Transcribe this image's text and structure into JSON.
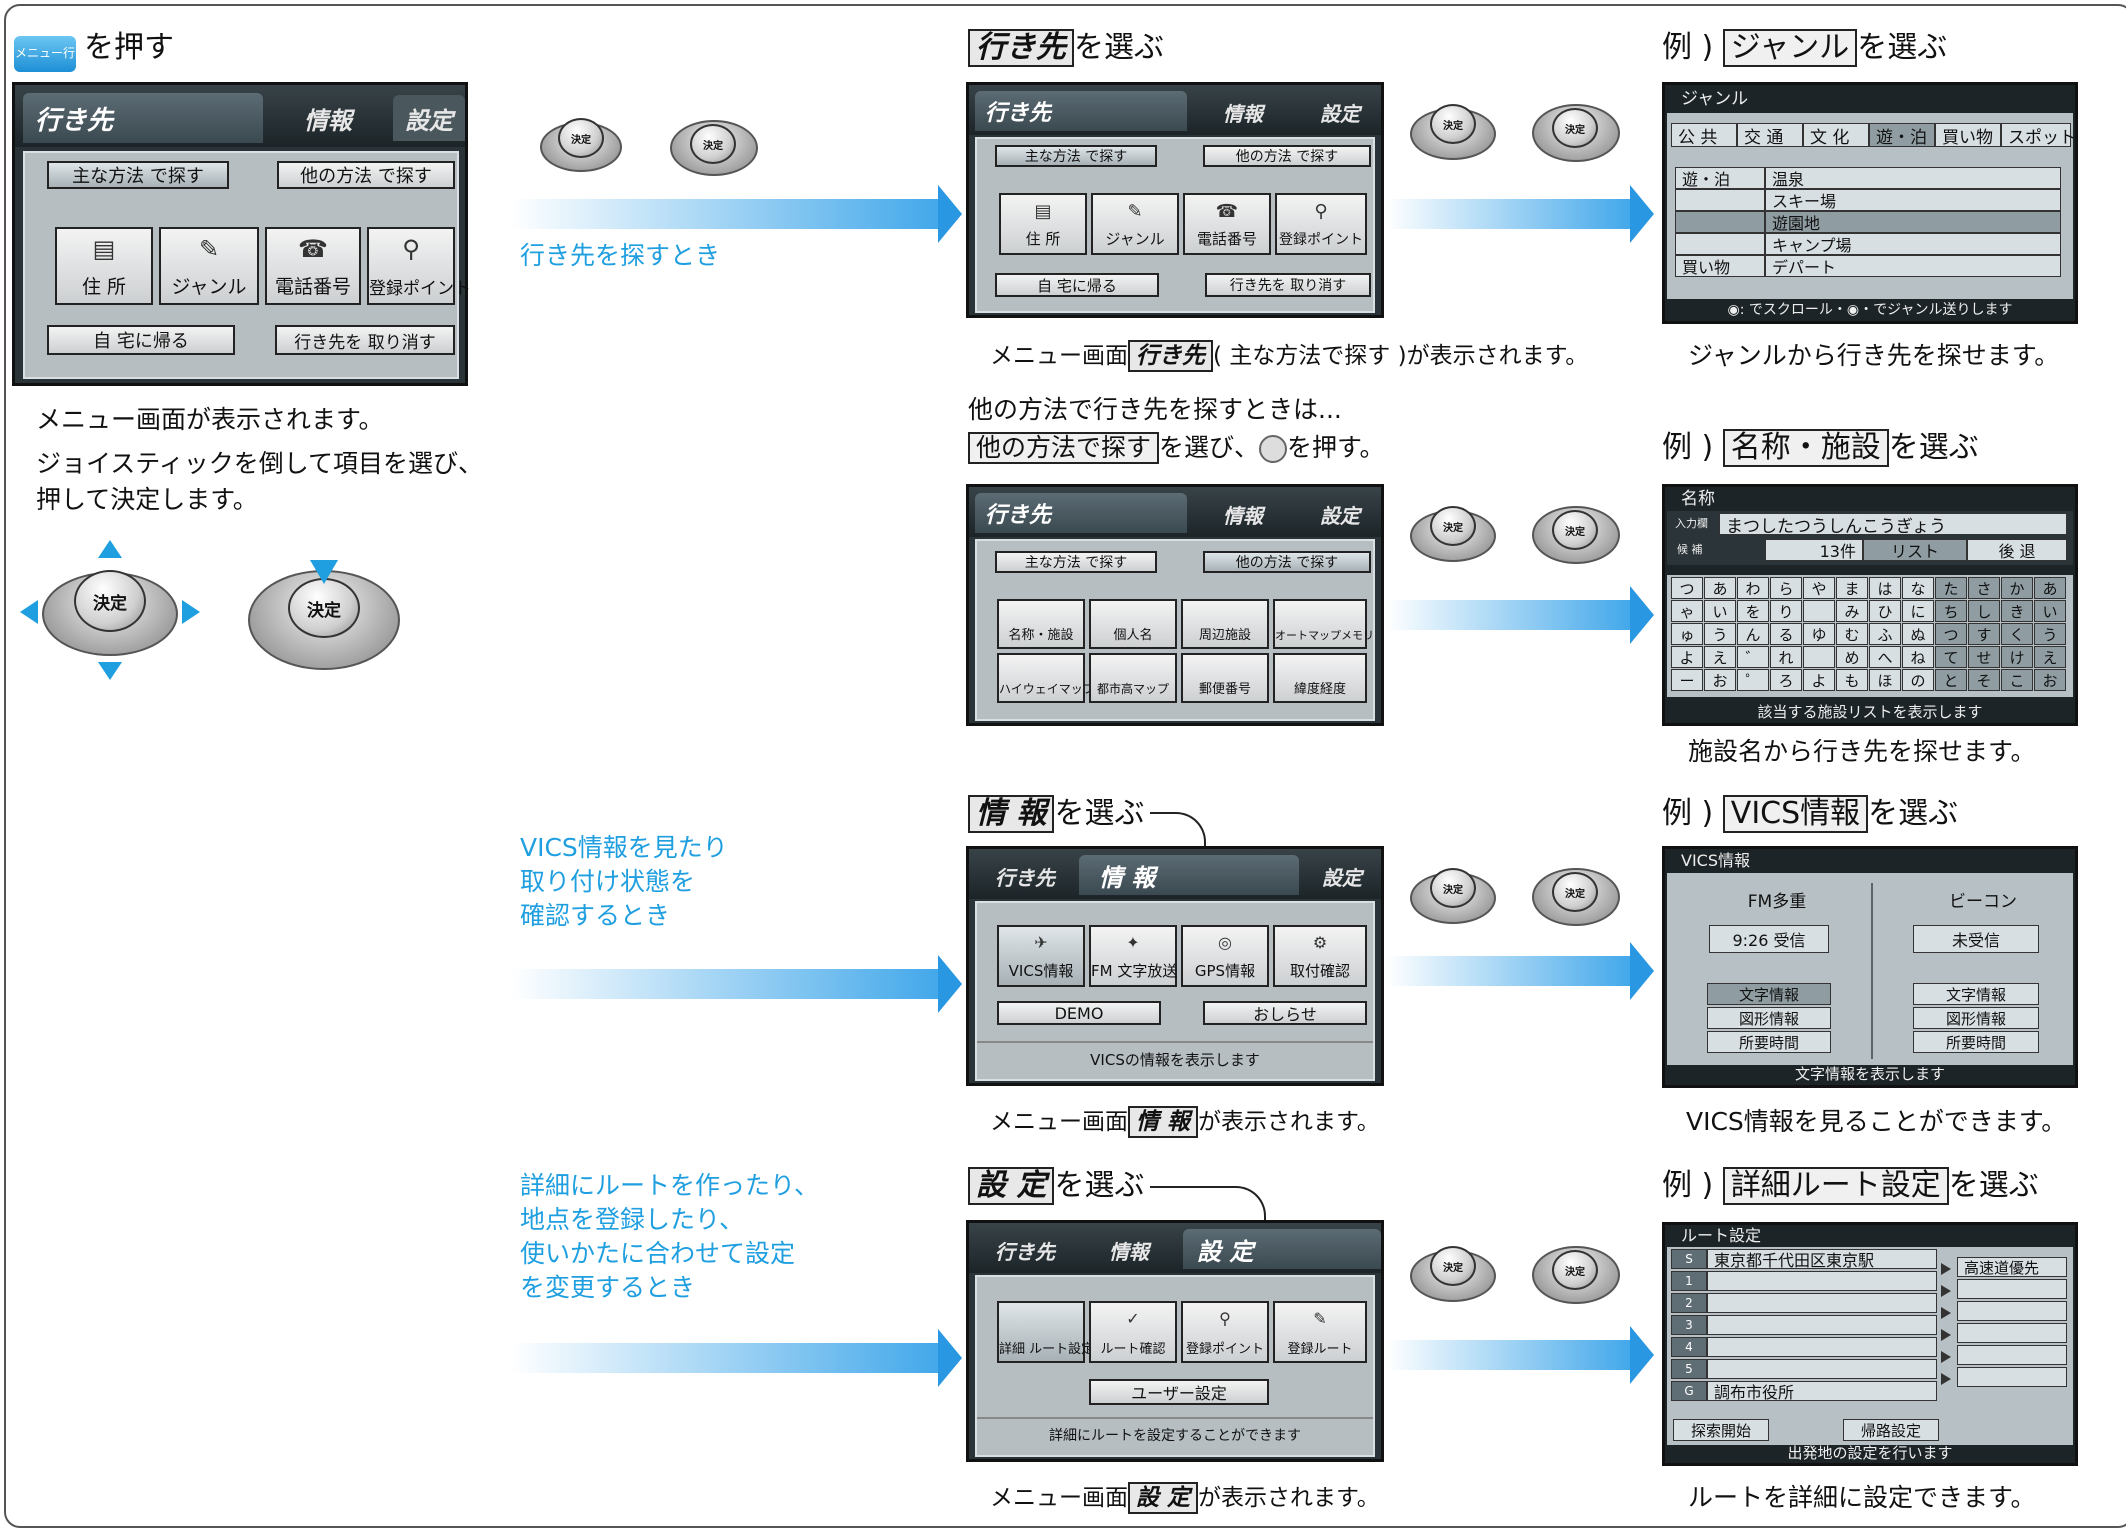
{
  "step1": {
    "key_icon_label": "メニュー行き先",
    "title": "を押す",
    "caption1": "メニュー画面が表示されます。",
    "caption2a": "ジョイスティックを倒して項目を選び、",
    "caption2b": "押して決定します。",
    "stick_label": "決定"
  },
  "flow": {
    "dest_note": "行き先を探すとき",
    "vics_note": [
      "VICS情報を見たり",
      "取り付け状態を",
      "確認するとき"
    ],
    "setting_note": [
      "詳細にルートを作ったり、",
      "地点を登録したり、",
      "使いかたに合わせて設定",
      "を変更するとき"
    ]
  },
  "dest_menu": {
    "tabs": [
      "行き先",
      "情報",
      "設定"
    ],
    "subtabs": [
      "主な方法 で探す",
      "他の方法 で探す"
    ],
    "buttons": [
      "住 所",
      "ジャンル",
      "電話番号",
      "登録ポイント"
    ],
    "bottom": [
      "自 宅に帰る",
      "行き先を 取り消す"
    ]
  },
  "col2": {
    "dest_title": "行き先",
    "dest_title_suffix": "を選ぶ",
    "dest_caption_prefix": "メニュー画面",
    "dest_caption_box": "行き先",
    "dest_caption_suffix": "( 主な方法で探す )が表示されます。",
    "other_intro": "他の方法で行き先を探すときは...",
    "other_box": "他の方法で探す",
    "other_suffix": "を選び、",
    "other_suffix2": "を押す。",
    "other_buttons": [
      "名称・施設",
      "個人名",
      "周辺施設",
      "オートマップメモリ",
      "ハイウェイマップ",
      "都市高マップ",
      "郵便番号",
      "緯度経度"
    ],
    "info_title": "情 報",
    "info_title_suffix": "を選ぶ",
    "info_tabs": [
      "行き先",
      "情 報",
      "設定"
    ],
    "info_buttons": [
      "VICS情報",
      "FM 文字放送",
      "GPS情報",
      "取付確認"
    ],
    "info_bottom": [
      "DEMO",
      "おしらせ"
    ],
    "info_status": "VICSの情報を表示します",
    "info_caption_prefix": "メニュー画面",
    "info_caption_box": "情 報",
    "info_caption_suffix": "が表示されます。",
    "set_title": "設 定",
    "set_title_suffix": "を選ぶ",
    "set_tabs": [
      "行き先",
      "情報",
      "設 定"
    ],
    "set_buttons": [
      "詳細 ルート設定",
      "ルート確認",
      "登録ポイント",
      "登録ルート"
    ],
    "set_bottom": "ユーザー設定",
    "set_status": "詳細にルートを設定することができます",
    "set_caption_prefix": "メニュー画面",
    "set_caption_box": "設 定",
    "set_caption_suffix": "が表示されます。"
  },
  "col3": {
    "ex_prefix": "例 )",
    "ex_suffix": "を選ぶ",
    "genre": {
      "select": "ジャンル",
      "screen_title": "ジャンル",
      "tabs": [
        "公 共",
        "交 通",
        "文 化",
        "遊・泊",
        "買い物",
        "スポット"
      ],
      "rows": [
        [
          "遊・泊",
          "温泉"
        ],
        [
          "",
          "スキー場"
        ],
        [
          "",
          "遊園地"
        ],
        [
          "",
          "キャンプ場"
        ],
        [
          "買い物",
          "デパート"
        ]
      ],
      "footer": "◉: でスクロール・◉・でジャンル送りします",
      "caption": "ジャンルから行き先を探せます。"
    },
    "name": {
      "select": "名称・施設",
      "screen_title": "名称",
      "input_label": "入力欄",
      "input_value": "まつしたつうしんこうぎょう",
      "cand_label": "候 補",
      "cand_count": "13件",
      "list_btn": "リスト",
      "back_btn": "後 退",
      "kana": [
        [
          "つ",
          "あ",
          "わ",
          "ら",
          "や",
          "ま",
          "は",
          "な",
          "た",
          "さ",
          "か",
          "あ"
        ],
        [
          "ゃ",
          "い",
          "を",
          "り",
          "",
          "み",
          "ひ",
          "に",
          "ち",
          "し",
          "き",
          "い"
        ],
        [
          "ゅ",
          "う",
          "ん",
          "る",
          "ゆ",
          "む",
          "ふ",
          "ぬ",
          "つ",
          "す",
          "く",
          "う"
        ],
        [
          "よ",
          "え",
          "゛",
          "れ",
          "",
          "め",
          "へ",
          "ね",
          "て",
          "せ",
          "け",
          "え"
        ],
        [
          "ー",
          "お",
          "゜",
          "ろ",
          "よ",
          "も",
          "ほ",
          "の",
          "と",
          "そ",
          "こ",
          "お"
        ]
      ],
      "footer": "該当する施設リストを表示します",
      "caption": "施設名から行き先を探せます。"
    },
    "vics": {
      "select": "VICS情報",
      "screen_title": "VICS情報",
      "col_left": "FM多重",
      "col_right": "ビーコン",
      "left_status": "9:26 受信",
      "right_status": "未受信",
      "buttons": [
        "文字情報",
        "図形情報",
        "所要時間"
      ],
      "footer": "文字情報を表示します",
      "caption": "VICS情報を見ることができます。"
    },
    "route": {
      "select": "詳細ルート設定",
      "screen_title": "ルート設定",
      "rows": [
        [
          "S",
          "東京都千代田区東京駅"
        ],
        [
          "1",
          ""
        ],
        [
          "2",
          ""
        ],
        [
          "3",
          ""
        ],
        [
          "4",
          ""
        ],
        [
          "5",
          ""
        ],
        [
          "G",
          "調布市役所"
        ]
      ],
      "side": [
        "高速道優先",
        "",
        "",
        "",
        "",
        ""
      ],
      "buttons": [
        "探索開始",
        "帰路設定"
      ],
      "footer": "出発地の設定を行います",
      "caption": "ルートを詳細に設定できます。"
    }
  }
}
